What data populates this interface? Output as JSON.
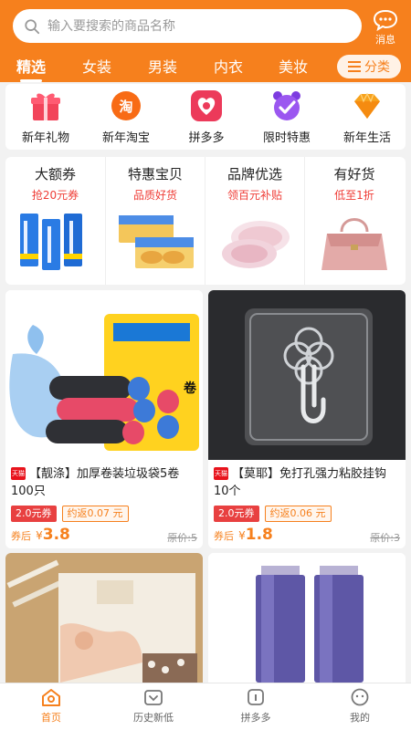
{
  "search": {
    "placeholder": "输入要搜索的商品名称"
  },
  "header": {
    "message_label": "消息"
  },
  "tabs": [
    "精选",
    "女装",
    "男装",
    "内衣",
    "美妆"
  ],
  "category_button": "分类",
  "categories": [
    {
      "label": "新年礼物",
      "icon": "gift-icon"
    },
    {
      "label": "新年淘宝",
      "icon": "taobao-icon"
    },
    {
      "label": "拼多多",
      "icon": "pinduoduo-icon"
    },
    {
      "label": "限时特惠",
      "icon": "alarm-clock-icon"
    },
    {
      "label": "新年生活",
      "icon": "diamond-icon"
    }
  ],
  "promos": [
    {
      "title": "大额券",
      "subtitle": "抢20元券"
    },
    {
      "title": "特惠宝贝",
      "subtitle": "品质好货"
    },
    {
      "title": "品牌优选",
      "subtitle": "领百元补贴"
    },
    {
      "title": "有好货",
      "subtitle": "低至1折"
    }
  ],
  "products": [
    {
      "shop_badge": "天猫",
      "title": "【靓涤】加厚卷装垃圾袋5卷100只",
      "coupon": "2.0元券",
      "rebate": "约返0.07 元",
      "after_label": "券后",
      "currency": "¥",
      "price": "3.8",
      "original": "原价:5"
    },
    {
      "shop_badge": "天猫",
      "title": "【莫耶】免打孔强力粘胶挂钩10个",
      "coupon": "2.0元券",
      "rebate": "约返0.06 元",
      "after_label": "券后",
      "currency": "¥",
      "price": "1.8",
      "original": "原价:3"
    }
  ],
  "nav": [
    {
      "label": "首页",
      "active": true
    },
    {
      "label": "历史新低",
      "active": false
    },
    {
      "label": "拼多多",
      "active": false
    },
    {
      "label": "我的",
      "active": false
    }
  ],
  "colors": {
    "accent": "#f6801d",
    "red": "#ef3d37"
  }
}
